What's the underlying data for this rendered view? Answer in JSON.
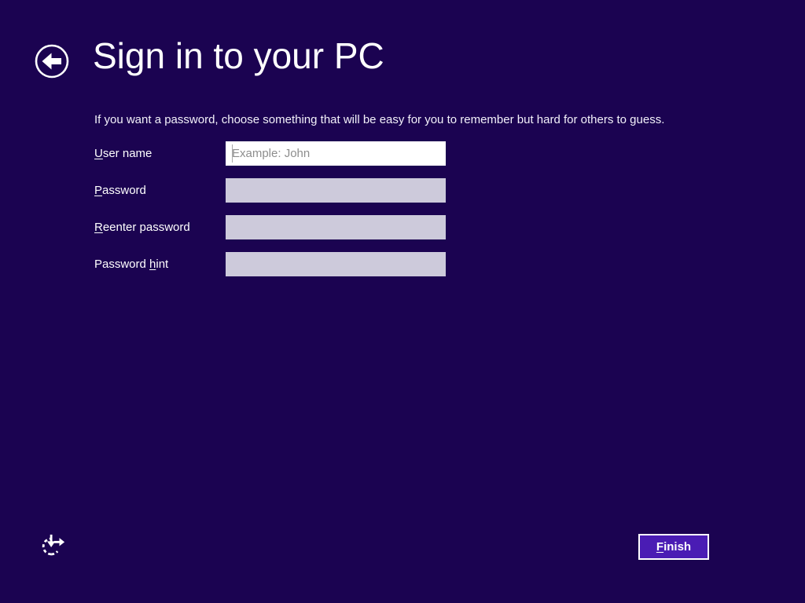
{
  "colors": {
    "background": "#1b0351",
    "accent_button": "#4a1cb4",
    "field_disabled": "#cdcadb",
    "text": "#ffffff",
    "placeholder_text": "#8d8d8d"
  },
  "header": {
    "title": "Sign in to your PC",
    "back_icon": "back-arrow-circle"
  },
  "intro": "If you want a password, choose something that will be easy for you to remember but hard for others to guess.",
  "form": {
    "fields": [
      {
        "id": "username",
        "label_pre": "",
        "label_accel": "U",
        "label_post": "ser name",
        "placeholder": "Example: John",
        "value": ""
      },
      {
        "id": "password",
        "label_pre": "",
        "label_accel": "P",
        "label_post": "assword",
        "placeholder": "",
        "value": ""
      },
      {
        "id": "reenter-password",
        "label_pre": "",
        "label_accel": "R",
        "label_post": "eenter password",
        "placeholder": "",
        "value": ""
      },
      {
        "id": "password-hint",
        "label_pre": "Password ",
        "label_accel": "h",
        "label_post": "int",
        "placeholder": "",
        "value": ""
      }
    ]
  },
  "footer": {
    "ease_of_access_icon": "ease-of-access",
    "finish": {
      "label_pre": "",
      "label_accel": "F",
      "label_post": "inish"
    }
  }
}
